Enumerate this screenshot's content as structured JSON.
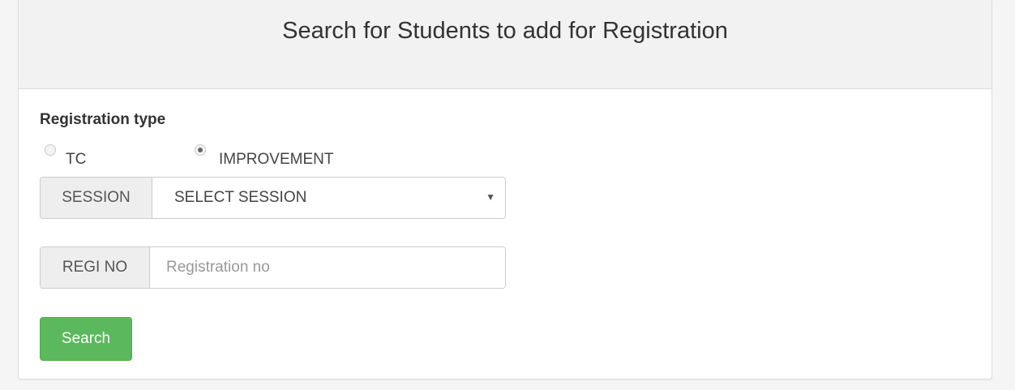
{
  "panel": {
    "title": "Search for Students to add for Registration"
  },
  "registration_type": {
    "label": "Registration type",
    "options": [
      {
        "label": "TC",
        "checked": false
      },
      {
        "label": "IMPROVEMENT",
        "checked": true
      }
    ]
  },
  "session": {
    "addon_label": "SESSION",
    "selected": "SELECT SESSION",
    "caret": "▼"
  },
  "regi_no": {
    "addon_label": "REGI NO",
    "value": "",
    "placeholder": "Registration no"
  },
  "actions": {
    "search_label": "Search"
  },
  "colors": {
    "heading_bg": "#f2f2f2",
    "button_success": "#5cb85c",
    "addon_bg": "#eeeeee"
  }
}
